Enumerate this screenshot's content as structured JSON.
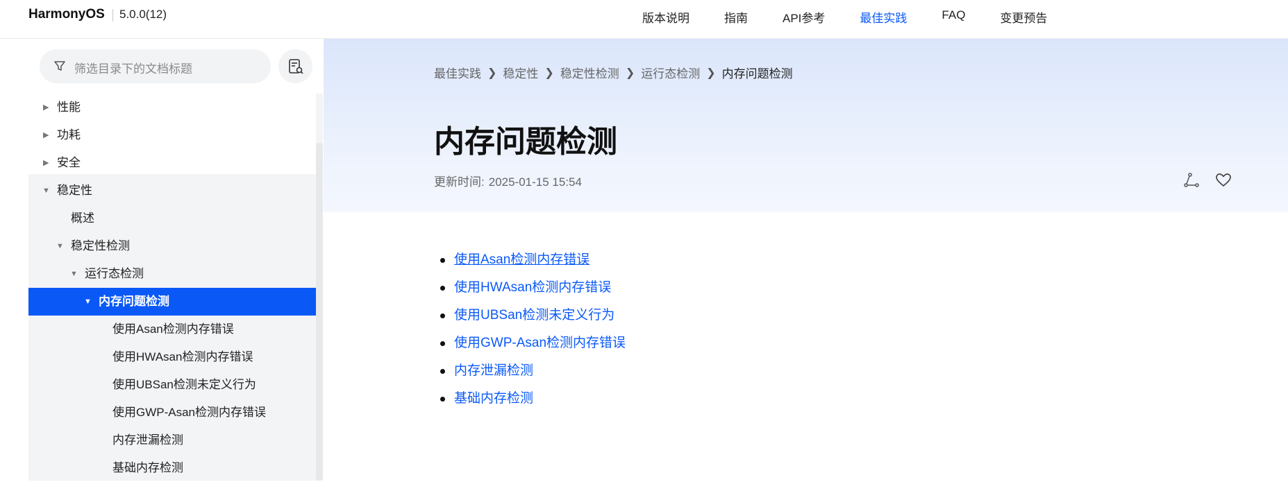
{
  "header": {
    "brand": "HarmonyOS",
    "version": "5.0.0(12)",
    "nav": [
      {
        "label": "版本说明",
        "active": false
      },
      {
        "label": "指南",
        "active": false
      },
      {
        "label": "API参考",
        "active": false
      },
      {
        "label": "最佳实践",
        "active": true
      },
      {
        "label": "FAQ",
        "active": false
      },
      {
        "label": "变更预告",
        "active": false
      }
    ],
    "accent_color": "#0a59f7"
  },
  "sidebar": {
    "filter_placeholder": "筛选目录下的文档标题",
    "filter_icon": "funnel-icon",
    "doc_button_icon": "document-search-icon",
    "items": [
      {
        "label": "性能",
        "expander": "collapsed",
        "active": false
      },
      {
        "label": "功耗",
        "expander": "collapsed",
        "active": false
      },
      {
        "label": "安全",
        "expander": "collapsed",
        "active": false
      },
      {
        "label": "稳定性",
        "expander": "expanded",
        "active": false
      },
      {
        "label": "概述",
        "expander": "none",
        "active": false
      },
      {
        "label": "稳定性检测",
        "expander": "expanded",
        "active": false
      },
      {
        "label": "运行态检测",
        "expander": "expanded",
        "active": false
      },
      {
        "label": "内存问题检测",
        "expander": "expanded",
        "active": true
      },
      {
        "label": "使用Asan检测内存错误",
        "expander": "none",
        "active": false
      },
      {
        "label": "使用HWAsan检测内存错误",
        "expander": "none",
        "active": false
      },
      {
        "label": "使用UBSan检测未定义行为",
        "expander": "none",
        "active": false
      },
      {
        "label": "使用GWP-Asan检测内存错误",
        "expander": "none",
        "active": false
      },
      {
        "label": "内存泄漏检测",
        "expander": "none",
        "active": false
      },
      {
        "label": "基础内存检测",
        "expander": "none",
        "active": false
      }
    ]
  },
  "main": {
    "breadcrumb": [
      "最佳实践",
      "稳定性",
      "稳定性检测",
      "运行态检测",
      "内存问题检测"
    ],
    "title": "内存问题检测",
    "updated_label": "更新时间:",
    "updated_value": "2025-01-15 15:54",
    "action_icons": [
      "share-icon",
      "heart-icon"
    ],
    "links": [
      "使用Asan检测内存错误",
      "使用HWAsan检测内存错误",
      "使用UBSan检测未定义行为",
      "使用GWP-Asan检测内存错误",
      "内存泄漏检测",
      "基础内存检测"
    ]
  }
}
